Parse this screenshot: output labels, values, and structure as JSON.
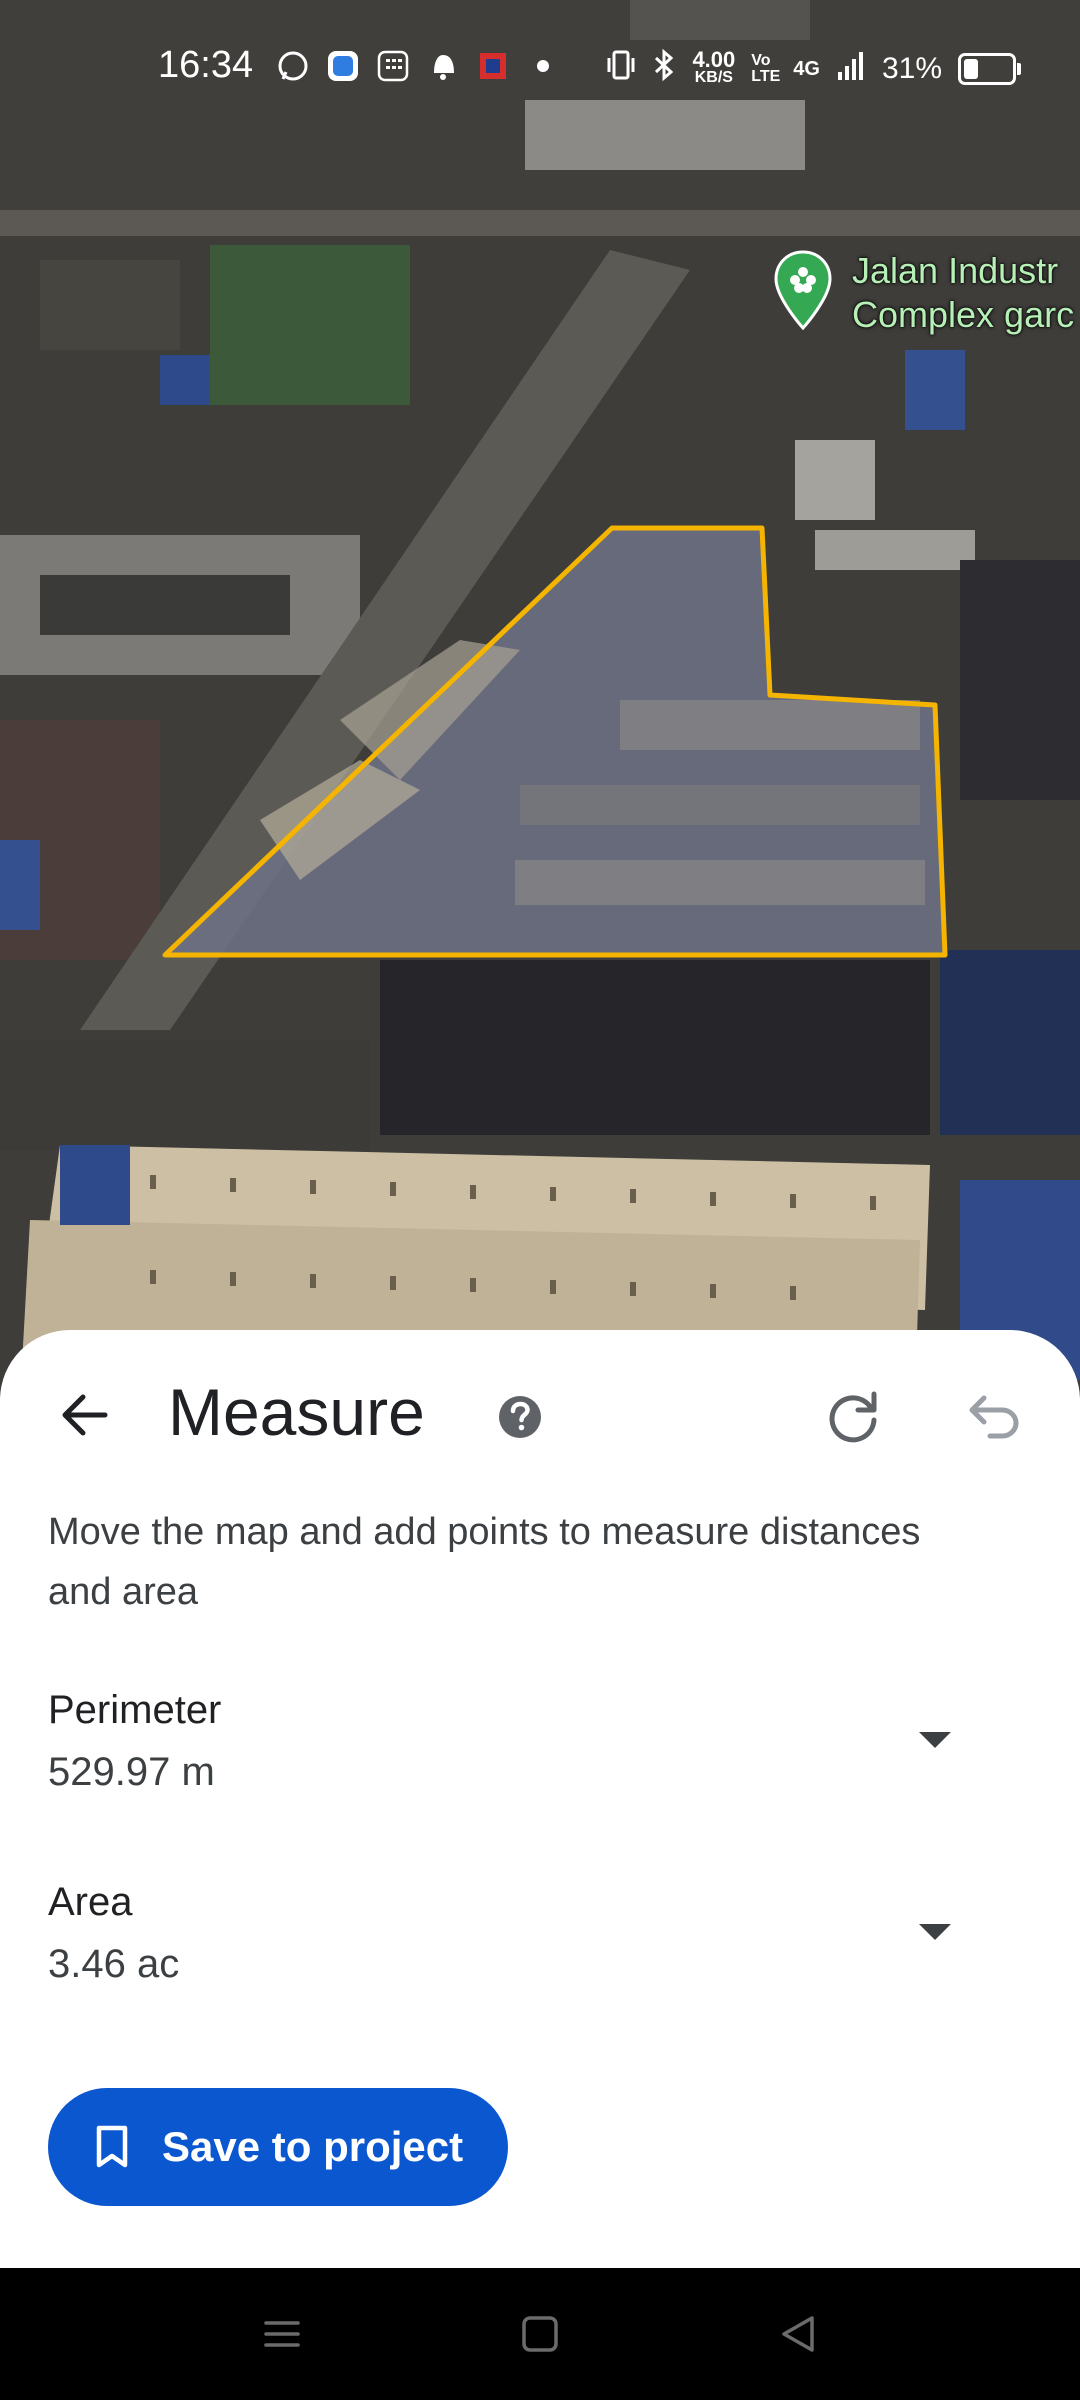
{
  "status_bar": {
    "time": "16:34",
    "net_speed_value": "4.00",
    "net_speed_unit": "KB/S",
    "volte": "Vo LTE",
    "network": "4G",
    "battery": "31%",
    "battery_level": 0.31,
    "notification_icons": [
      "whatsapp-icon",
      "blue-app-icon",
      "calculator-icon",
      "bell-icon",
      "red-square-app-icon",
      "dot-icon"
    ],
    "system_icons": [
      "vibrate-icon",
      "bluetooth-icon",
      "signal-icon",
      "battery-icon"
    ]
  },
  "map": {
    "view": "satellite",
    "place_name_line1": "Jalan Industr",
    "place_name_line2": "Complex garc",
    "polygon_color": "#f4b400"
  },
  "measure": {
    "title": "Measure",
    "hint": "Move the map and add points to measure distances and area",
    "perimeter_label": "Perimeter",
    "perimeter_value": "529.97 m",
    "area_label": "Area",
    "area_value": "3.46 ac",
    "save_label": "Save to project"
  },
  "colors": {
    "accent": "#0b57d0",
    "text_primary": "#202124",
    "text_secondary": "#3c4043",
    "icon": "#5f6368"
  }
}
